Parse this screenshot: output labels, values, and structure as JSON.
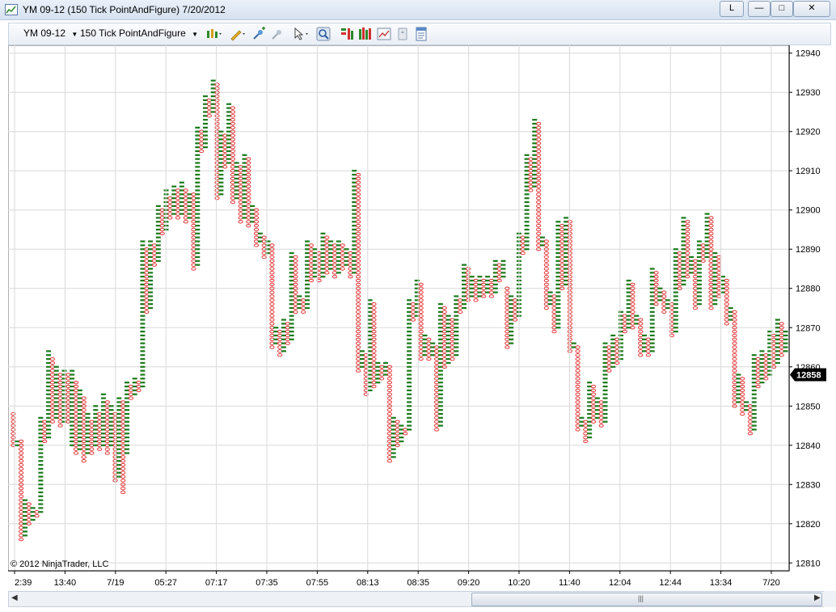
{
  "window": {
    "title": "YM 09-12 (150 Tick PointAndFigure)  7/20/2012",
    "buttons": {
      "link": "L",
      "minimize": "—",
      "maximize": "□",
      "close": "✕"
    }
  },
  "toolbar": {
    "instrument": "YM 09-12",
    "period": "150 Tick PointAndFigure",
    "icons": [
      "chart-style-icon",
      "drawing-tool-icon",
      "zoom-in-icon",
      "zoom-out-icon",
      "cursor-icon",
      "search-icon",
      "indicators-icon",
      "strategies-icon",
      "chart-properties-icon",
      "data-box-icon",
      "properties-icon"
    ]
  },
  "colors": {
    "x_box": "#1a7a1a",
    "o_box": "#e03030",
    "grid": "#d9d9d9",
    "last_price_bg": "#000000"
  },
  "chart_data": {
    "type": "point_and_figure",
    "instrument": "YM 09-12",
    "box_size": 1,
    "copyright": "© 2012 NinjaTrader, LLC",
    "last_price": "12858",
    "ylim": [
      12808,
      12942
    ],
    "y_ticks": [
      12810,
      12820,
      12830,
      12840,
      12850,
      12860,
      12870,
      12880,
      12890,
      12900,
      12910,
      12920,
      12930,
      12940
    ],
    "x_tick_labels": [
      "2:39",
      "13:40",
      "7/19",
      "05:27",
      "07:17",
      "07:35",
      "07:55",
      "08:13",
      "08:35",
      "09:20",
      "10:20",
      "11:40",
      "12:04",
      "12:44",
      "13:34",
      "7/20"
    ],
    "columns": [
      {
        "t": "O",
        "hi": 12848,
        "lo": 12840
      },
      {
        "t": "X",
        "hi": 12841,
        "lo": 12840
      },
      {
        "t": "O",
        "hi": 12841,
        "lo": 12816
      },
      {
        "t": "X",
        "hi": 12826,
        "lo": 12817
      },
      {
        "t": "O",
        "hi": 12825,
        "lo": 12820
      },
      {
        "t": "X",
        "hi": 12824,
        "lo": 12821
      },
      {
        "t": "O",
        "hi": 12823,
        "lo": 12822
      },
      {
        "t": "X",
        "hi": 12847,
        "lo": 12823
      },
      {
        "t": "O",
        "hi": 12846,
        "lo": 12841
      },
      {
        "t": "X",
        "hi": 12864,
        "lo": 12842
      },
      {
        "t": "O",
        "hi": 12862,
        "lo": 12846
      },
      {
        "t": "X",
        "hi": 12860,
        "lo": 12847
      },
      {
        "t": "O",
        "hi": 12858,
        "lo": 12845
      },
      {
        "t": "X",
        "hi": 12859,
        "lo": 12846
      },
      {
        "t": "O",
        "hi": 12858,
        "lo": 12846
      },
      {
        "t": "X",
        "hi": 12859,
        "lo": 12840
      },
      {
        "t": "O",
        "hi": 12856,
        "lo": 12838
      },
      {
        "t": "X",
        "hi": 12854,
        "lo": 12839
      },
      {
        "t": "O",
        "hi": 12852,
        "lo": 12836
      },
      {
        "t": "X",
        "hi": 12848,
        "lo": 12838
      },
      {
        "t": "O",
        "hi": 12846,
        "lo": 12838
      },
      {
        "t": "X",
        "hi": 12850,
        "lo": 12840
      },
      {
        "t": "O",
        "hi": 12848,
        "lo": 12839
      },
      {
        "t": "X",
        "hi": 12853,
        "lo": 12840
      },
      {
        "t": "O",
        "hi": 12851,
        "lo": 12838
      },
      {
        "t": "X",
        "hi": 12850,
        "lo": 12840
      },
      {
        "t": "O",
        "hi": 12848,
        "lo": 12831
      },
      {
        "t": "X",
        "hi": 12852,
        "lo": 12832
      },
      {
        "t": "O",
        "hi": 12851,
        "lo": 12828
      },
      {
        "t": "X",
        "hi": 12856,
        "lo": 12838
      },
      {
        "t": "O",
        "hi": 12855,
        "lo": 12852
      },
      {
        "t": "X",
        "hi": 12857,
        "lo": 12853
      },
      {
        "t": "O",
        "hi": 12856,
        "lo": 12854
      },
      {
        "t": "X",
        "hi": 12892,
        "lo": 12855
      },
      {
        "t": "O",
        "hi": 12890,
        "lo": 12874
      },
      {
        "t": "X",
        "hi": 12892,
        "lo": 12875
      },
      {
        "t": "O",
        "hi": 12891,
        "lo": 12886
      },
      {
        "t": "X",
        "hi": 12901,
        "lo": 12887
      },
      {
        "t": "O",
        "hi": 12900,
        "lo": 12894
      },
      {
        "t": "X",
        "hi": 12905,
        "lo": 12895
      },
      {
        "t": "O",
        "hi": 12903,
        "lo": 12898
      },
      {
        "t": "X",
        "hi": 12906,
        "lo": 12899
      },
      {
        "t": "O",
        "hi": 12905,
        "lo": 12898
      },
      {
        "t": "X",
        "hi": 12907,
        "lo": 12899
      },
      {
        "t": "O",
        "hi": 12905,
        "lo": 12897
      },
      {
        "t": "X",
        "hi": 12904,
        "lo": 12898
      },
      {
        "t": "O",
        "hi": 12904,
        "lo": 12885
      },
      {
        "t": "X",
        "hi": 12921,
        "lo": 12886
      },
      {
        "t": "O",
        "hi": 12920,
        "lo": 12915
      },
      {
        "t": "X",
        "hi": 12929,
        "lo": 12916
      },
      {
        "t": "O",
        "hi": 12928,
        "lo": 12924
      },
      {
        "t": "X",
        "hi": 12933,
        "lo": 12925
      },
      {
        "t": "O",
        "hi": 12932,
        "lo": 12903
      },
      {
        "t": "X",
        "hi": 12920,
        "lo": 12904
      },
      {
        "t": "O",
        "hi": 12919,
        "lo": 12911
      },
      {
        "t": "X",
        "hi": 12927,
        "lo": 12912
      },
      {
        "t": "O",
        "hi": 12926,
        "lo": 12902
      },
      {
        "t": "X",
        "hi": 12912,
        "lo": 12903
      },
      {
        "t": "O",
        "hi": 12911,
        "lo": 12897
      },
      {
        "t": "X",
        "hi": 12914,
        "lo": 12898
      },
      {
        "t": "O",
        "hi": 12913,
        "lo": 12896
      },
      {
        "t": "X",
        "hi": 12901,
        "lo": 12897
      },
      {
        "t": "O",
        "hi": 12900,
        "lo": 12891
      },
      {
        "t": "X",
        "hi": 12894,
        "lo": 12892
      },
      {
        "t": "O",
        "hi": 12893,
        "lo": 12888
      },
      {
        "t": "X",
        "hi": 12892,
        "lo": 12889
      },
      {
        "t": "O",
        "hi": 12891,
        "lo": 12865
      },
      {
        "t": "X",
        "hi": 12870,
        "lo": 12866
      },
      {
        "t": "O",
        "hi": 12869,
        "lo": 12863
      },
      {
        "t": "X",
        "hi": 12872,
        "lo": 12864
      },
      {
        "t": "O",
        "hi": 12871,
        "lo": 12866
      },
      {
        "t": "X",
        "hi": 12889,
        "lo": 12867
      },
      {
        "t": "O",
        "hi": 12888,
        "lo": 12874
      },
      {
        "t": "X",
        "hi": 12878,
        "lo": 12875
      },
      {
        "t": "O",
        "hi": 12877,
        "lo": 12874
      },
      {
        "t": "X",
        "hi": 12892,
        "lo": 12875
      },
      {
        "t": "O",
        "hi": 12891,
        "lo": 12882
      },
      {
        "t": "X",
        "hi": 12890,
        "lo": 12883
      },
      {
        "t": "O",
        "hi": 12889,
        "lo": 12882
      },
      {
        "t": "X",
        "hi": 12894,
        "lo": 12883
      },
      {
        "t": "O",
        "hi": 12893,
        "lo": 12884
      },
      {
        "t": "X",
        "hi": 12892,
        "lo": 12885
      },
      {
        "t": "O",
        "hi": 12891,
        "lo": 12883
      },
      {
        "t": "X",
        "hi": 12892,
        "lo": 12884
      },
      {
        "t": "O",
        "hi": 12891,
        "lo": 12885
      },
      {
        "t": "X",
        "hi": 12890,
        "lo": 12886
      },
      {
        "t": "O",
        "hi": 12889,
        "lo": 12883
      },
      {
        "t": "X",
        "hi": 12910,
        "lo": 12884
      },
      {
        "t": "O",
        "hi": 12909,
        "lo": 12859
      },
      {
        "t": "X",
        "hi": 12864,
        "lo": 12860
      },
      {
        "t": "O",
        "hi": 12863,
        "lo": 12853
      },
      {
        "t": "X",
        "hi": 12877,
        "lo": 12854
      },
      {
        "t": "O",
        "hi": 12876,
        "lo": 12855
      },
      {
        "t": "X",
        "hi": 12861,
        "lo": 12856
      },
      {
        "t": "O",
        "hi": 12860,
        "lo": 12857
      },
      {
        "t": "X",
        "hi": 12861,
        "lo": 12858
      },
      {
        "t": "O",
        "hi": 12860,
        "lo": 12836
      },
      {
        "t": "X",
        "hi": 12847,
        "lo": 12837
      },
      {
        "t": "O",
        "hi": 12846,
        "lo": 12840
      },
      {
        "t": "X",
        "hi": 12845,
        "lo": 12841
      },
      {
        "t": "O",
        "hi": 12844,
        "lo": 12843
      },
      {
        "t": "X",
        "hi": 12877,
        "lo": 12844
      },
      {
        "t": "O",
        "hi": 12876,
        "lo": 12872
      },
      {
        "t": "X",
        "hi": 12882,
        "lo": 12873
      },
      {
        "t": "O",
        "hi": 12881,
        "lo": 12862
      },
      {
        "t": "X",
        "hi": 12868,
        "lo": 12863
      },
      {
        "t": "O",
        "hi": 12867,
        "lo": 12862
      },
      {
        "t": "X",
        "hi": 12866,
        "lo": 12863
      },
      {
        "t": "O",
        "hi": 12865,
        "lo": 12844
      },
      {
        "t": "X",
        "hi": 12876,
        "lo": 12845
      },
      {
        "t": "O",
        "hi": 12875,
        "lo": 12860
      },
      {
        "t": "X",
        "hi": 12873,
        "lo": 12861
      },
      {
        "t": "O",
        "hi": 12872,
        "lo": 12862
      },
      {
        "t": "X",
        "hi": 12878,
        "lo": 12863
      },
      {
        "t": "O",
        "hi": 12877,
        "lo": 12874
      },
      {
        "t": "X",
        "hi": 12886,
        "lo": 12875
      },
      {
        "t": "O",
        "hi": 12885,
        "lo": 12877
      },
      {
        "t": "X",
        "hi": 12883,
        "lo": 12878
      },
      {
        "t": "O",
        "hi": 12882,
        "lo": 12877
      },
      {
        "t": "X",
        "hi": 12883,
        "lo": 12878
      },
      {
        "t": "O",
        "hi": 12882,
        "lo": 12878
      },
      {
        "t": "X",
        "hi": 12883,
        "lo": 12879
      },
      {
        "t": "O",
        "hi": 12882,
        "lo": 12878
      },
      {
        "t": "X",
        "hi": 12887,
        "lo": 12879
      },
      {
        "t": "O",
        "hi": 12886,
        "lo": 12882
      },
      {
        "t": "X",
        "hi": 12887,
        "lo": 12883
      },
      {
        "t": "O",
        "hi": 12880,
        "lo": 12865
      },
      {
        "t": "X",
        "hi": 12878,
        "lo": 12866
      },
      {
        "t": "O",
        "hi": 12877,
        "lo": 12872
      },
      {
        "t": "X",
        "hi": 12894,
        "lo": 12873
      },
      {
        "t": "O",
        "hi": 12893,
        "lo": 12889
      },
      {
        "t": "X",
        "hi": 12914,
        "lo": 12890
      },
      {
        "t": "O",
        "hi": 12913,
        "lo": 12905
      },
      {
        "t": "X",
        "hi": 12923,
        "lo": 12906
      },
      {
        "t": "O",
        "hi": 12922,
        "lo": 12890
      },
      {
        "t": "X",
        "hi": 12893,
        "lo": 12891
      },
      {
        "t": "O",
        "hi": 12892,
        "lo": 12875
      },
      {
        "t": "X",
        "hi": 12879,
        "lo": 12876
      },
      {
        "t": "O",
        "hi": 12878,
        "lo": 12869
      },
      {
        "t": "X",
        "hi": 12897,
        "lo": 12870
      },
      {
        "t": "O",
        "hi": 12896,
        "lo": 12880
      },
      {
        "t": "X",
        "hi": 12898,
        "lo": 12881
      },
      {
        "t": "O",
        "hi": 12897,
        "lo": 12864
      },
      {
        "t": "X",
        "hi": 12866,
        "lo": 12865
      },
      {
        "t": "O",
        "hi": 12865,
        "lo": 12844
      },
      {
        "t": "X",
        "hi": 12847,
        "lo": 12845
      },
      {
        "t": "O",
        "hi": 12846,
        "lo": 12841
      },
      {
        "t": "X",
        "hi": 12856,
        "lo": 12842
      },
      {
        "t": "O",
        "hi": 12855,
        "lo": 12846
      },
      {
        "t": "X",
        "hi": 12852,
        "lo": 12847
      },
      {
        "t": "O",
        "hi": 12851,
        "lo": 12845
      },
      {
        "t": "X",
        "hi": 12866,
        "lo": 12846
      },
      {
        "t": "O",
        "hi": 12865,
        "lo": 12859
      },
      {
        "t": "X",
        "hi": 12868,
        "lo": 12860
      },
      {
        "t": "O",
        "hi": 12867,
        "lo": 12861
      },
      {
        "t": "X",
        "hi": 12874,
        "lo": 12862
      },
      {
        "t": "O",
        "hi": 12873,
        "lo": 12869
      },
      {
        "t": "X",
        "hi": 12882,
        "lo": 12870
      },
      {
        "t": "O",
        "hi": 12881,
        "lo": 12870
      },
      {
        "t": "X",
        "hi": 12873,
        "lo": 12871
      },
      {
        "t": "O",
        "hi": 12872,
        "lo": 12863
      },
      {
        "t": "X",
        "hi": 12868,
        "lo": 12864
      },
      {
        "t": "O",
        "hi": 12867,
        "lo": 12863
      },
      {
        "t": "X",
        "hi": 12885,
        "lo": 12864
      },
      {
        "t": "O",
        "hi": 12884,
        "lo": 12876
      },
      {
        "t": "X",
        "hi": 12880,
        "lo": 12877
      },
      {
        "t": "O",
        "hi": 12879,
        "lo": 12874
      },
      {
        "t": "X",
        "hi": 12877,
        "lo": 12875
      },
      {
        "t": "O",
        "hi": 12876,
        "lo": 12868
      },
      {
        "t": "X",
        "hi": 12890,
        "lo": 12869
      },
      {
        "t": "O",
        "hi": 12889,
        "lo": 12880
      },
      {
        "t": "X",
        "hi": 12898,
        "lo": 12881
      },
      {
        "t": "O",
        "hi": 12897,
        "lo": 12883
      },
      {
        "t": "X",
        "hi": 12888,
        "lo": 12884
      },
      {
        "t": "O",
        "hi": 12887,
        "lo": 12875
      },
      {
        "t": "X",
        "hi": 12892,
        "lo": 12876
      },
      {
        "t": "O",
        "hi": 12891,
        "lo": 12887
      },
      {
        "t": "X",
        "hi": 12899,
        "lo": 12888
      },
      {
        "t": "O",
        "hi": 12898,
        "lo": 12875
      },
      {
        "t": "X",
        "hi": 12889,
        "lo": 12876
      },
      {
        "t": "O",
        "hi": 12888,
        "lo": 12878
      },
      {
        "t": "X",
        "hi": 12883,
        "lo": 12879
      },
      {
        "t": "O",
        "hi": 12882,
        "lo": 12871
      },
      {
        "t": "X",
        "hi": 12875,
        "lo": 12872
      },
      {
        "t": "O",
        "hi": 12874,
        "lo": 12850
      },
      {
        "t": "X",
        "hi": 12858,
        "lo": 12851
      },
      {
        "t": "O",
        "hi": 12857,
        "lo": 12848
      },
      {
        "t": "X",
        "hi": 12851,
        "lo": 12849
      },
      {
        "t": "O",
        "hi": 12850,
        "lo": 12843
      },
      {
        "t": "X",
        "hi": 12863,
        "lo": 12844
      },
      {
        "t": "O",
        "hi": 12862,
        "lo": 12855
      },
      {
        "t": "X",
        "hi": 12864,
        "lo": 12856
      },
      {
        "t": "O",
        "hi": 12863,
        "lo": 12857
      },
      {
        "t": "X",
        "hi": 12869,
        "lo": 12858
      },
      {
        "t": "O",
        "hi": 12868,
        "lo": 12860
      },
      {
        "t": "X",
        "hi": 12872,
        "lo": 12861
      },
      {
        "t": "O",
        "hi": 12871,
        "lo": 12863
      },
      {
        "t": "X",
        "hi": 12869,
        "lo": 12864
      }
    ]
  }
}
